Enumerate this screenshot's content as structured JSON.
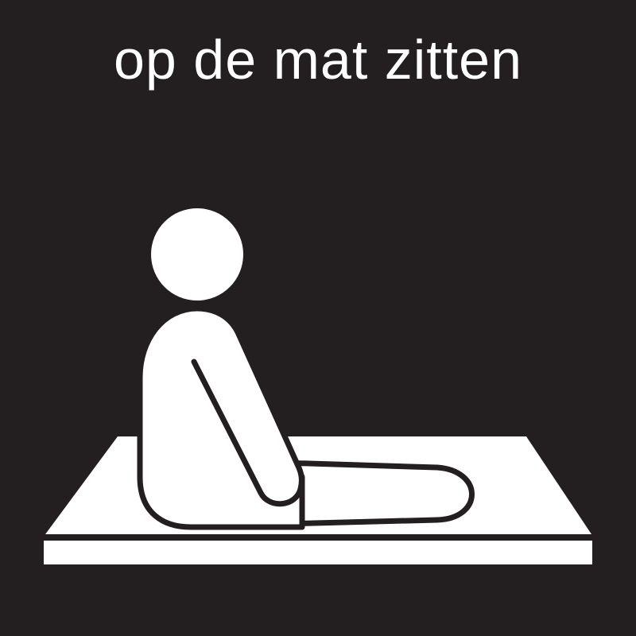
{
  "pictogram": {
    "caption": "op de mat zitten",
    "icon": "person-sitting-on-mat-icon",
    "colors": {
      "background": "#231f20",
      "foreground": "#ffffff"
    }
  }
}
